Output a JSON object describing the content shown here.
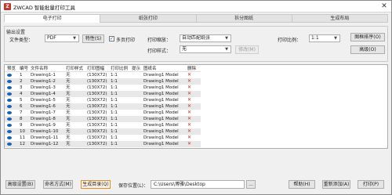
{
  "window": {
    "title": "ZWCAD 智能批量打印工具",
    "app_icon": "Z",
    "close_icon": "close-icon"
  },
  "tabs": [
    {
      "label": "电子打印",
      "active": true
    },
    {
      "label": "纸张打印",
      "active": false
    },
    {
      "label": "拆分图纸",
      "active": false
    },
    {
      "label": "生成布局",
      "active": false
    }
  ],
  "output": {
    "group_label": "输出设置",
    "file_type_label": "文件类型：",
    "file_type_value": "PDF",
    "properties_button": "特性(S)",
    "multi_file_label": "多页打印",
    "multi_file_checked": true,
    "print_size_label": "打印缩放：",
    "print_size_value": "自动匹配纸张",
    "print_style_label": "打印样式：",
    "print_style_value": "无",
    "modify_button": "修改(M)",
    "print_scale_label": "打印比例：",
    "print_scale_value": "1:1",
    "arrange_button": "图框排序(O)",
    "advanced_button": "高级(O)"
  },
  "table": {
    "columns": [
      "预览",
      "编号",
      "文件名称",
      "打印样式",
      "打印图幅",
      "打印比例",
      "提示",
      "图纸名",
      "删除"
    ],
    "rows": [
      {
        "no": "1",
        "name": "Drawing1-1",
        "style": "无",
        "size": "(130X72)",
        "scale": "1:1",
        "hint": "",
        "sheet": "Drawing1 Model"
      },
      {
        "no": "2",
        "name": "Drawing1-2",
        "style": "无",
        "size": "(130X72)",
        "scale": "1:1",
        "hint": "",
        "sheet": "Drawing1 Model"
      },
      {
        "no": "3",
        "name": "Drawing1-3",
        "style": "无",
        "size": "(130X72)",
        "scale": "1:1",
        "hint": "",
        "sheet": "Drawing1 Model"
      },
      {
        "no": "4",
        "name": "Drawing1-4",
        "style": "无",
        "size": "(130X72)",
        "scale": "1:1",
        "hint": "",
        "sheet": "Drawing1 Model"
      },
      {
        "no": "5",
        "name": "Drawing1-5",
        "style": "无",
        "size": "(130X72)",
        "scale": "1:1",
        "hint": "",
        "sheet": "Drawing1 Model"
      },
      {
        "no": "6",
        "name": "Drawing1-6",
        "style": "无",
        "size": "(130X72)",
        "scale": "1:1",
        "hint": "",
        "sheet": "Drawing1 Model"
      },
      {
        "no": "7",
        "name": "Drawing1-7",
        "style": "无",
        "size": "(130X72)",
        "scale": "1:1",
        "hint": "",
        "sheet": "Drawing1 Model"
      },
      {
        "no": "8",
        "name": "Drawing1-8",
        "style": "无",
        "size": "(130X72)",
        "scale": "1:1",
        "hint": "",
        "sheet": "Drawing1 Model"
      },
      {
        "no": "9",
        "name": "Drawing1-9",
        "style": "无",
        "size": "(130X72)",
        "scale": "1:1",
        "hint": "",
        "sheet": "Drawing1 Model"
      },
      {
        "no": "10",
        "name": "Drawing1-10",
        "style": "无",
        "size": "(130X72)",
        "scale": "1:1",
        "hint": "",
        "sheet": "Drawing1 Model"
      },
      {
        "no": "11",
        "name": "Drawing1-11",
        "style": "无",
        "size": "(130X72)",
        "scale": "1:1",
        "hint": "",
        "sheet": "Drawing1 Model"
      },
      {
        "no": "12",
        "name": "Drawing1-12",
        "style": "无",
        "size": "(130X72)",
        "scale": "1:1",
        "hint": "",
        "sheet": "Drawing1 Model"
      }
    ],
    "delete_glyph": "✕"
  },
  "footer": {
    "advanced_settings_button": "高级设置(B)",
    "naming_button": "命名方式(M)",
    "generate_button": "生成目录(Q)",
    "save_location_label": "保存位置(L)：",
    "save_location_value": "C:\\Users\\博雅\\Desktop",
    "browse_button": "…",
    "help_button": "帮助(H)",
    "reset_button": "重新添加(A)",
    "print_button": "打印(P)"
  },
  "colors": {
    "accent": "#1a5fb4",
    "delete": "#d62828",
    "highlight": "#e08a2a"
  }
}
